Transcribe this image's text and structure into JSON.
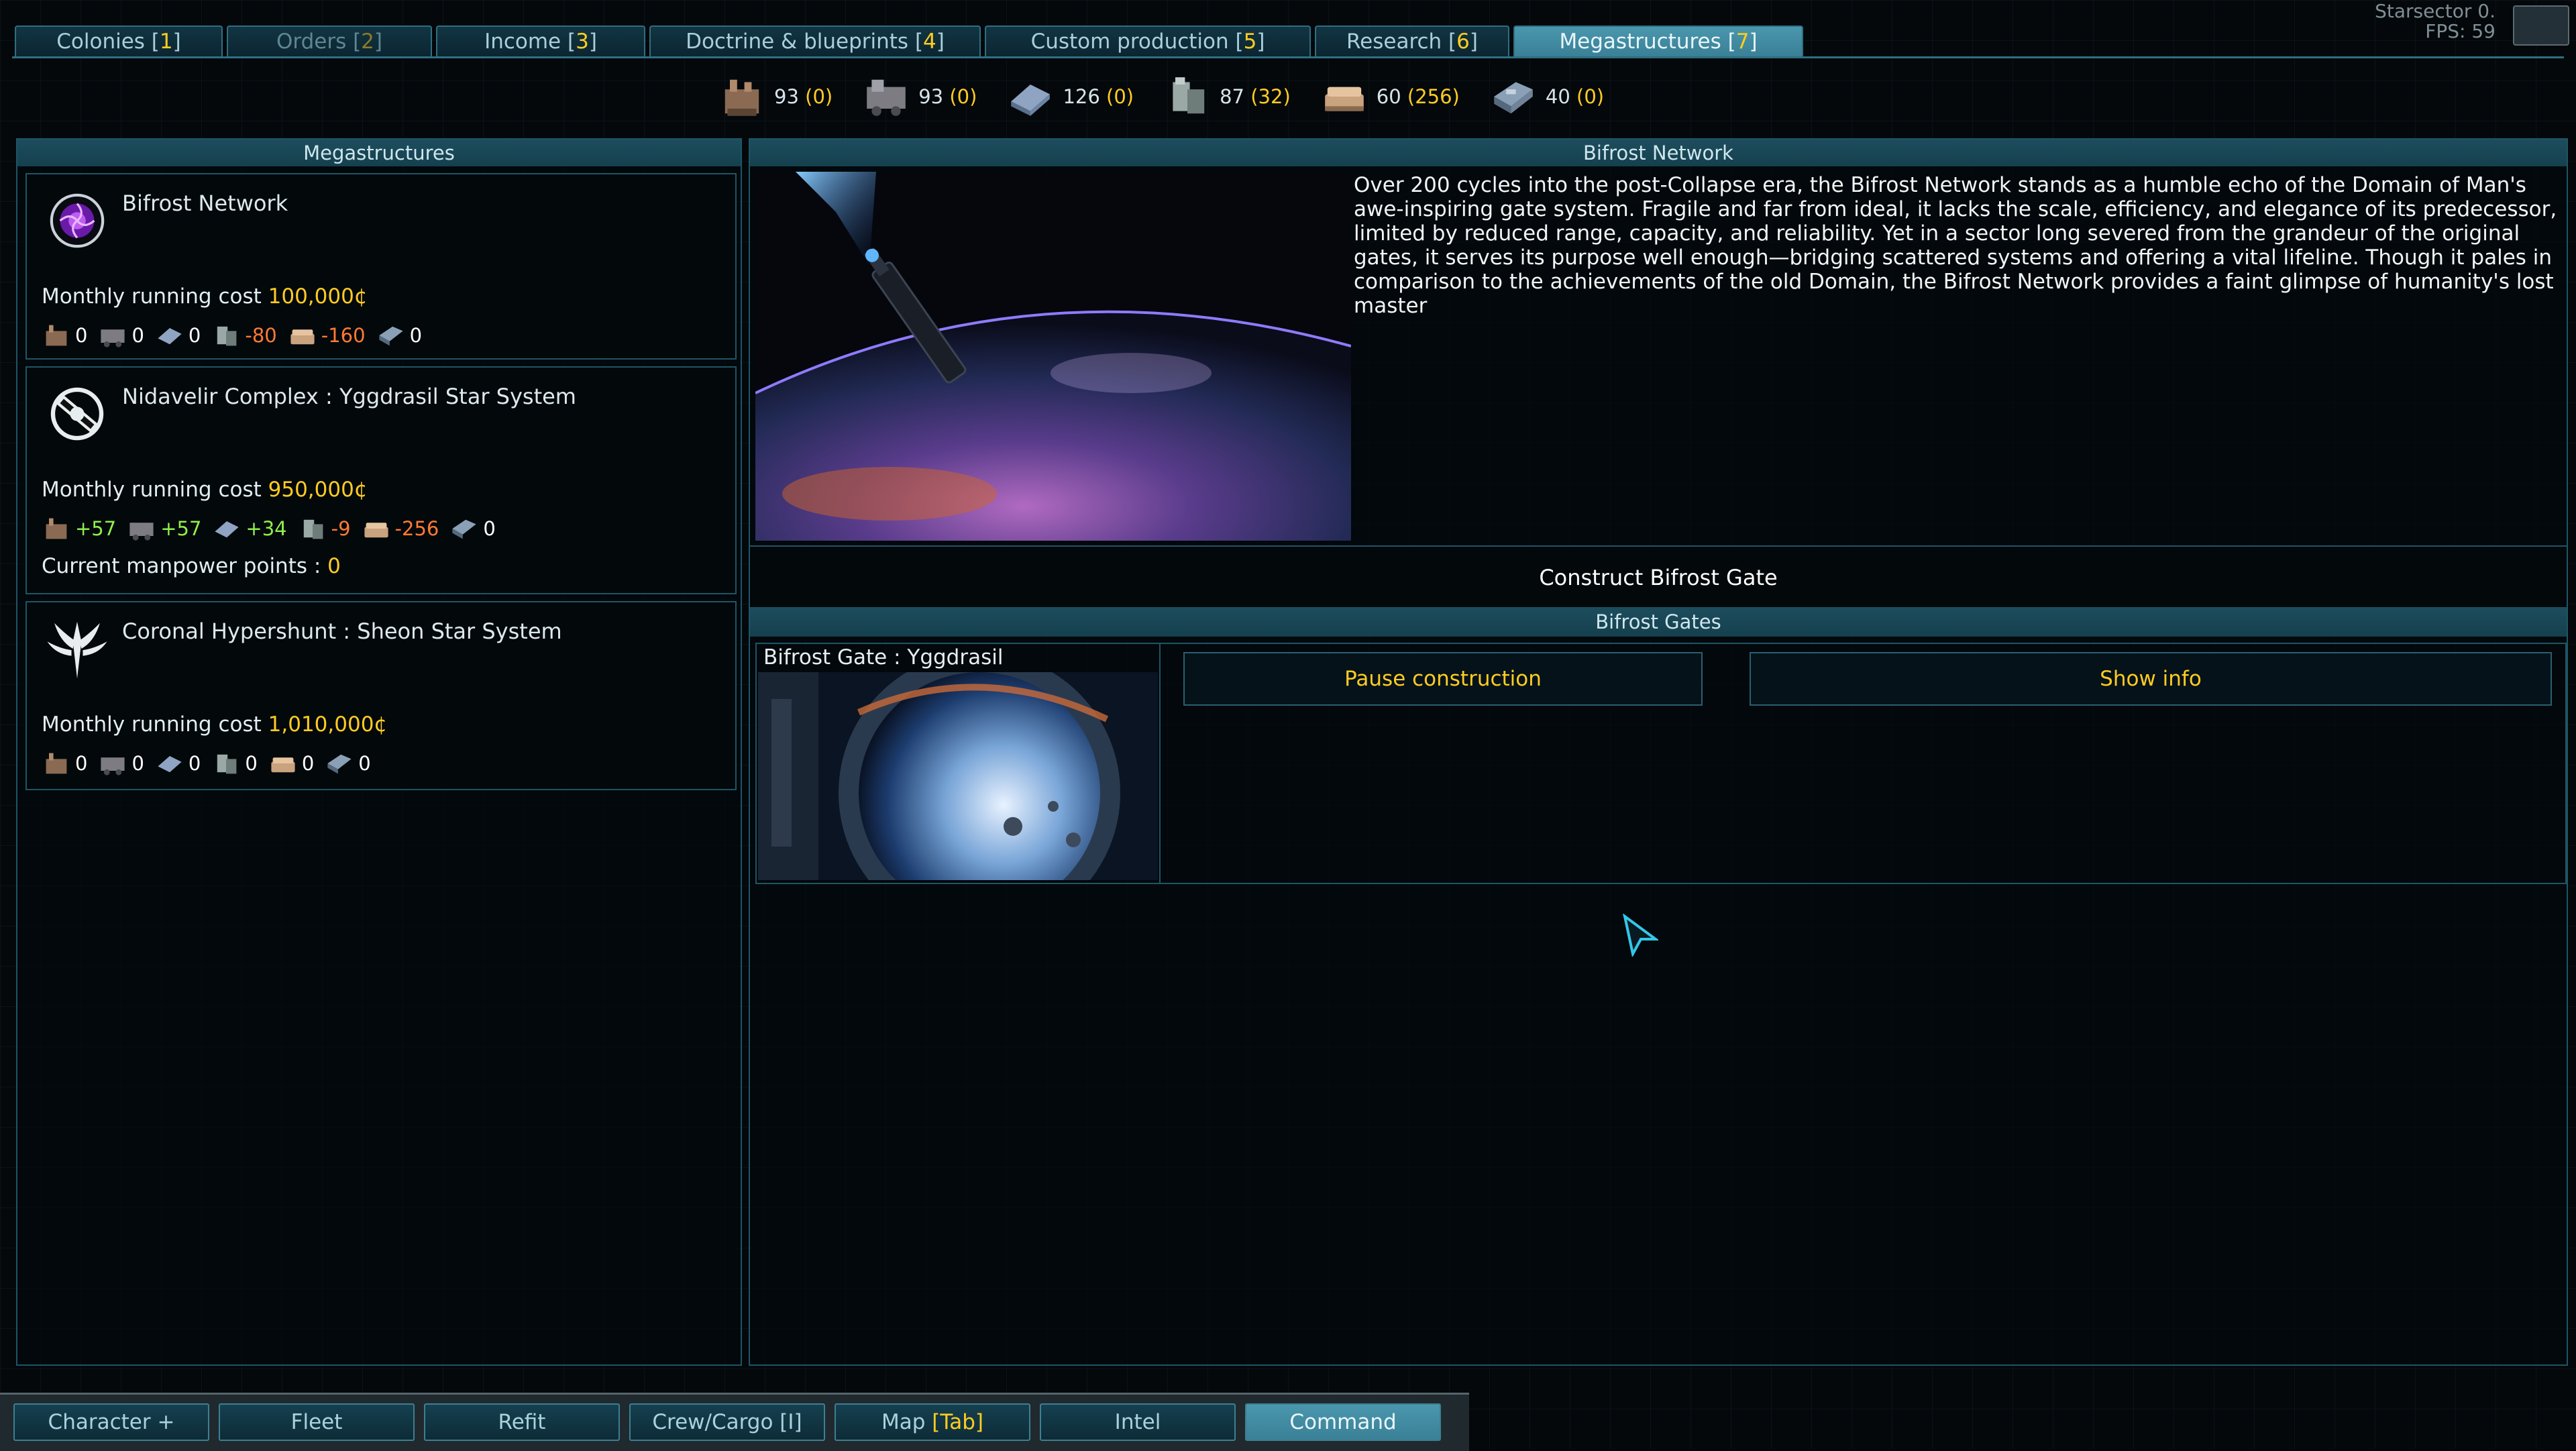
{
  "top_tabs": [
    {
      "name": "Colonies",
      "num": "1"
    },
    {
      "name": "Orders",
      "num": "2"
    },
    {
      "name": "Income",
      "num": "3"
    },
    {
      "name": "Doctrine & blueprints",
      "num": "4"
    },
    {
      "name": "Custom production",
      "num": "5"
    },
    {
      "name": "Research",
      "num": "6"
    },
    {
      "name": "Megastructures",
      "num": "7"
    }
  ],
  "fps": {
    "line1": "Starsector 0.",
    "line2": "FPS: 59"
  },
  "resources": [
    {
      "icon": "crew-icon",
      "value": "93",
      "extra": "(0)"
    },
    {
      "icon": "supplies-icon",
      "value": "93",
      "extra": "(0)"
    },
    {
      "icon": "heavy-machinery-icon",
      "value": "126",
      "extra": "(0)"
    },
    {
      "icon": "metals-icon",
      "value": "87",
      "extra": "(32)"
    },
    {
      "icon": "ore-icon",
      "value": "60",
      "extra": "(256)"
    },
    {
      "icon": "fuel-icon",
      "value": "40",
      "extra": "(0)"
    }
  ],
  "left_panel": {
    "title": "Megastructures",
    "items": [
      {
        "title": "Bifrost Network",
        "cost_label": "Monthly running cost",
        "cost_value": "100,000¢",
        "res": [
          "0",
          "0",
          "0",
          "-80",
          "-160",
          "0"
        ]
      },
      {
        "title": "Nidavelir Complex : Yggdrasil Star System",
        "cost_label": "Monthly running cost",
        "cost_value": "950,000¢",
        "res": [
          "+57",
          "+57",
          "+34",
          "-9",
          "-256",
          "0"
        ],
        "manpower_label": "Current manpower points :",
        "manpower_value": "0"
      },
      {
        "title": "Coronal Hypershunt : Sheon Star System",
        "cost_label": "Monthly running cost",
        "cost_value": "1,010,000¢",
        "res": [
          "0",
          "0",
          "0",
          "0",
          "0",
          "0"
        ]
      }
    ]
  },
  "right_panel": {
    "title": "Bifrost Network",
    "description": "Over 200 cycles into the post-Collapse era, the Bifrost Network stands as a humble echo of the Domain of Man's awe-inspiring gate system. Fragile and far from ideal, it lacks the scale, efficiency, and elegance of its predecessor, limited by reduced range, capacity, and reliability. Yet in a sector long severed from the grandeur of the original gates, it serves its purpose well enough—bridging scattered systems and offering a vital lifeline. Though it pales in comparison to the achievements of the old Domain, the Bifrost Network provides a faint glimpse of humanity's lost master",
    "construct_label": "Construct Bifrost Gate",
    "gates_header": "Bifrost Gates",
    "gates": [
      {
        "name": "Bifrost Gate : Yggdrasil",
        "pause_label": "Pause construction",
        "info_label": "Show info"
      }
    ]
  },
  "bottom_nav": [
    {
      "label": "Character",
      "hotkey": "+"
    },
    {
      "label": "Fleet",
      "hotkey": ""
    },
    {
      "label": "Refit",
      "hotkey": ""
    },
    {
      "label": "Crew/Cargo",
      "hotkey": "[I]"
    },
    {
      "label": "Map",
      "hotkey": "[Tab]"
    },
    {
      "label": "Intel",
      "hotkey": ""
    },
    {
      "label": "Command",
      "hotkey": ""
    }
  ],
  "colors": {
    "accent": "#2e6f82",
    "highlight": "#ffcc22",
    "negative": "#ff7a33",
    "positive": "#8ff04a"
  }
}
